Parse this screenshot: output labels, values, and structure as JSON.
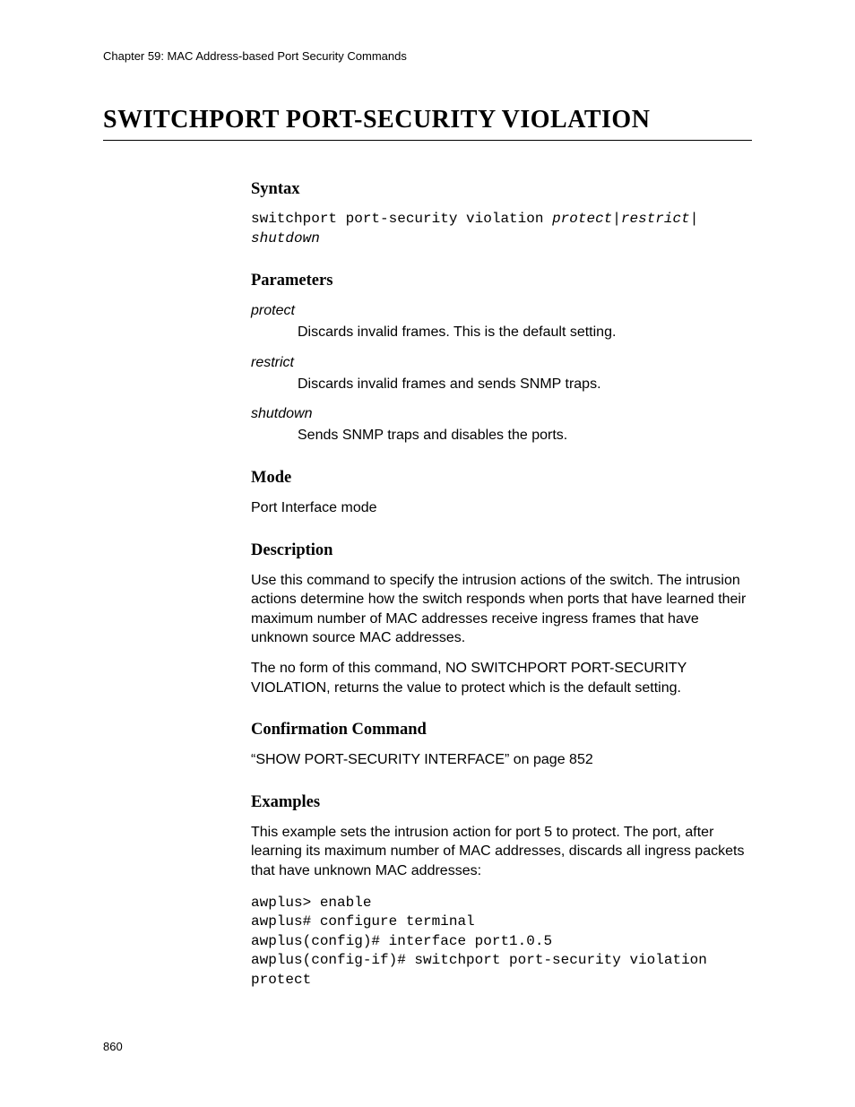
{
  "header": {
    "chapter": "Chapter 59: MAC Address-based Port Security Commands"
  },
  "title": "SWITCHPORT PORT-SECURITY VIOLATION",
  "sections": {
    "syntax": {
      "heading": "Syntax",
      "cmd_fixed": "switchport port-security violation ",
      "cmd_italic1": "protect",
      "cmd_sep1": "|",
      "cmd_italic2": "restrict",
      "cmd_sep2": "|\n",
      "cmd_italic3": "shutdown"
    },
    "parameters": {
      "heading": "Parameters",
      "items": [
        {
          "term": "protect",
          "desc": "Discards invalid frames. This is the default setting."
        },
        {
          "term": "restrict",
          "desc": "Discards invalid frames and sends SNMP traps."
        },
        {
          "term": "shutdown",
          "desc": "Sends SNMP traps and disables the ports."
        }
      ]
    },
    "mode": {
      "heading": "Mode",
      "text": "Port Interface mode"
    },
    "description": {
      "heading": "Description",
      "p1": "Use this command to specify the intrusion actions of the switch. The intrusion actions determine how the switch responds when ports that have learned their maximum number of MAC addresses receive ingress frames that have unknown source MAC addresses.",
      "p2": "The no form of this command, NO SWITCHPORT PORT-SECURITY VIOLATION, returns the value to protect which is the default setting."
    },
    "confirmation": {
      "heading": "Confirmation Command",
      "text": "“SHOW PORT-SECURITY INTERFACE” on page 852"
    },
    "examples": {
      "heading": "Examples",
      "intro": "This example sets the intrusion action for port 5 to protect. The port, after learning its maximum number of MAC addresses, discards all ingress packets that have unknown MAC addresses:",
      "code": "awplus> enable\nawplus# configure terminal\nawplus(config)# interface port1.0.5\nawplus(config-if)# switchport port-security violation protect"
    }
  },
  "page_number": "860"
}
